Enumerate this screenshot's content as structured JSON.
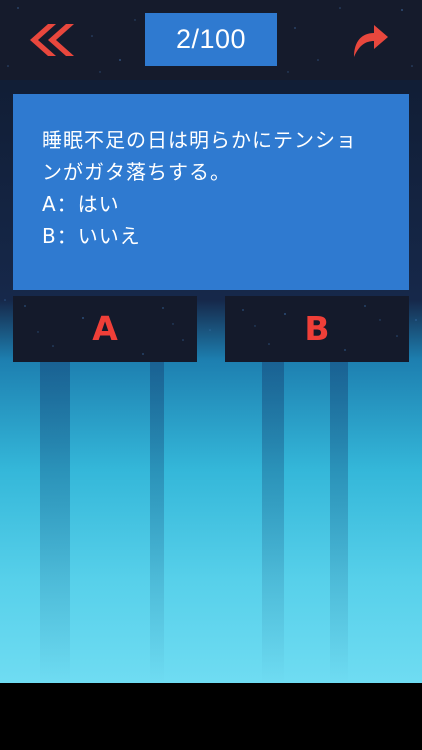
{
  "header": {
    "back_icon": "double-chevron-left-icon",
    "counter": "2/100",
    "share_icon": "share-arrow-icon"
  },
  "question": {
    "lines": [
      "睡眠不足の日は明らかにテンショ",
      "ンがガタ落ちする。",
      "A：はい",
      "B：いいえ"
    ]
  },
  "answers": {
    "a_label": "A",
    "b_label": "B"
  },
  "colors": {
    "accent_blue": "#2f7ad0",
    "accent_red": "#ef3f38",
    "dark_panel": "#151b2c"
  }
}
